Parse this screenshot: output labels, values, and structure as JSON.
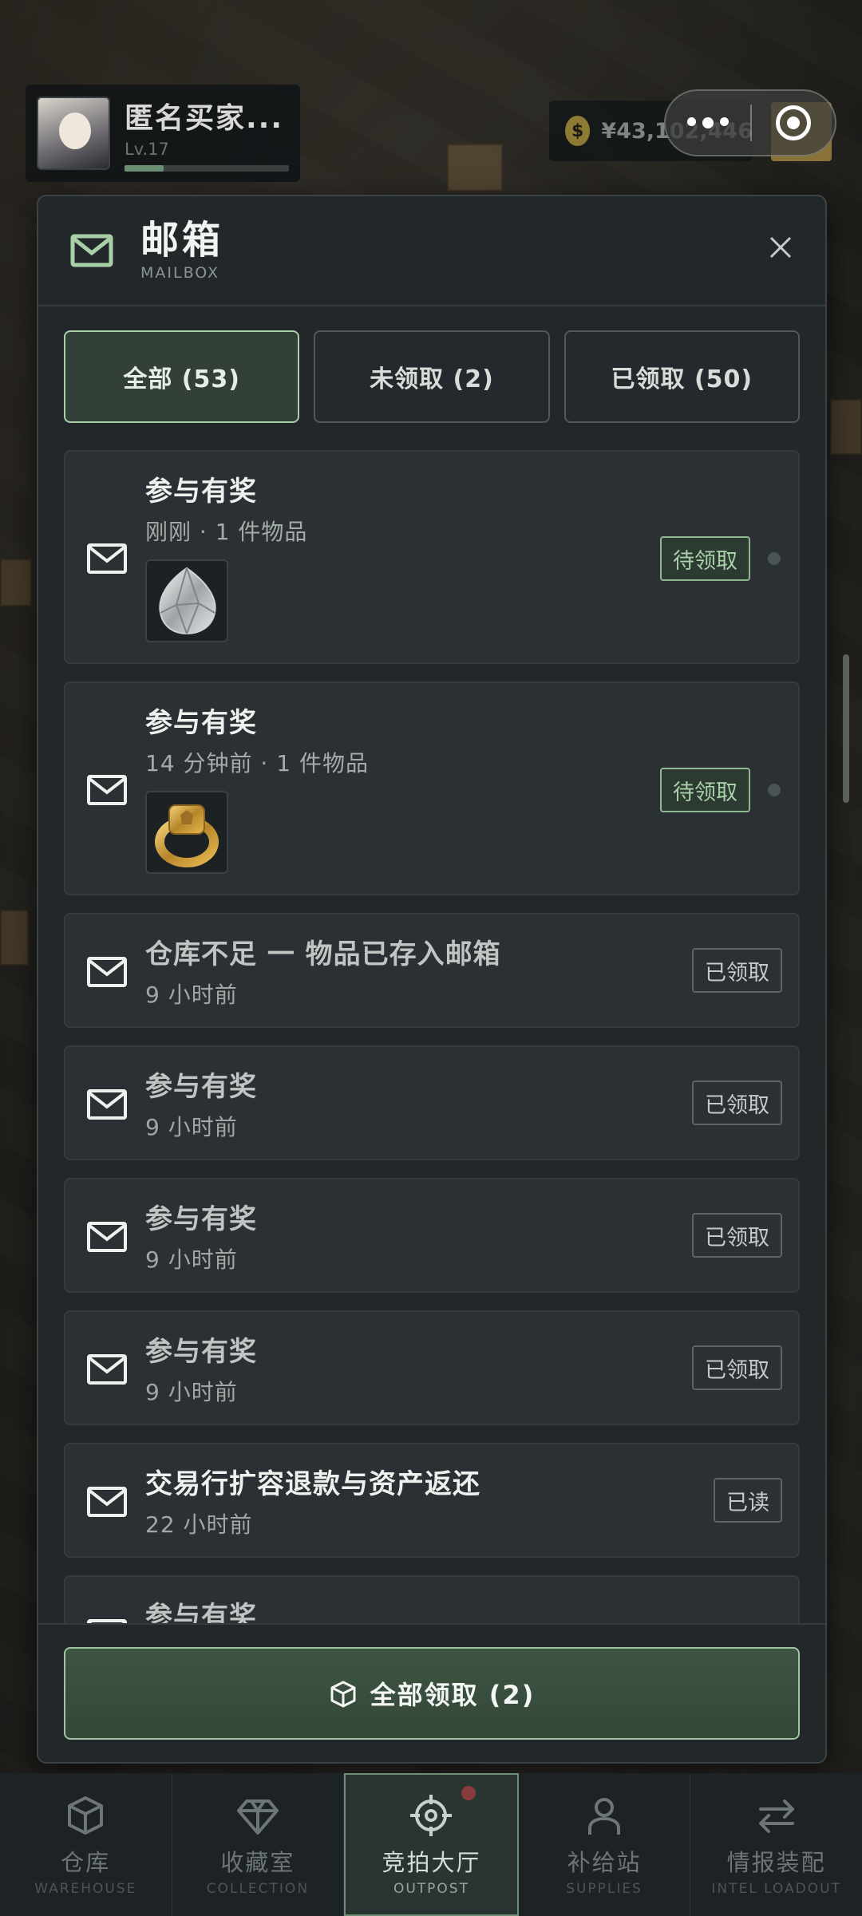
{
  "player": {
    "name": "匿名买家...",
    "level": "Lv.17",
    "xp_fraction": 0.24
  },
  "currency": {
    "symbol": "$",
    "value": "¥43,102,446"
  },
  "mailbox": {
    "title": "邮箱",
    "subtitle": "MAILBOX",
    "tabs": [
      {
        "label": "全部 (53)",
        "active": true
      },
      {
        "label": "未领取 (2)",
        "active": false
      },
      {
        "label": "已领取 (50)",
        "active": false
      }
    ],
    "items": [
      {
        "title": "参与有奖",
        "meta": "刚刚 · 1 件物品",
        "status": "待领取",
        "attachment": "diamond-icon"
      },
      {
        "title": "参与有奖",
        "meta": "14 分钟前 · 1 件物品",
        "status": "待领取",
        "attachment": "gold-ring-icon"
      },
      {
        "title": "仓库不足 一 物品已存入邮箱",
        "meta": "9 小时前",
        "status": "已领取"
      },
      {
        "title": "参与有奖",
        "meta": "9 小时前",
        "status": "已领取"
      },
      {
        "title": "参与有奖",
        "meta": "9 小时前",
        "status": "已领取"
      },
      {
        "title": "参与有奖",
        "meta": "9 小时前",
        "status": "已领取"
      },
      {
        "title": "交易行扩容退款与资产返还",
        "meta": "22 小时前",
        "status": "已读"
      },
      {
        "title": "参与有奖",
        "meta": "",
        "status": ""
      }
    ],
    "claim_all_label": "全部领取 (2)"
  },
  "nav": [
    {
      "label": "仓库",
      "sub": "WAREHOUSE",
      "icon": "cube-icon",
      "active": false
    },
    {
      "label": "收藏室",
      "sub": "COLLECTION",
      "icon": "gem-icon",
      "active": false
    },
    {
      "label": "竞拍大厅",
      "sub": "OUTPOST",
      "icon": "target-icon",
      "active": true
    },
    {
      "label": "补给站",
      "sub": "SUPPLIES",
      "icon": "person-icon",
      "active": false
    },
    {
      "label": "情报装配",
      "sub": "INTEL LOADOUT",
      "icon": "swap-arrows-icon",
      "active": false
    }
  ],
  "colors": {
    "accent_green": "#a9cfa9",
    "panel_bg": "#22272a",
    "pending_text": "#a8d1aa",
    "notification_red": "#8a3c3c"
  }
}
